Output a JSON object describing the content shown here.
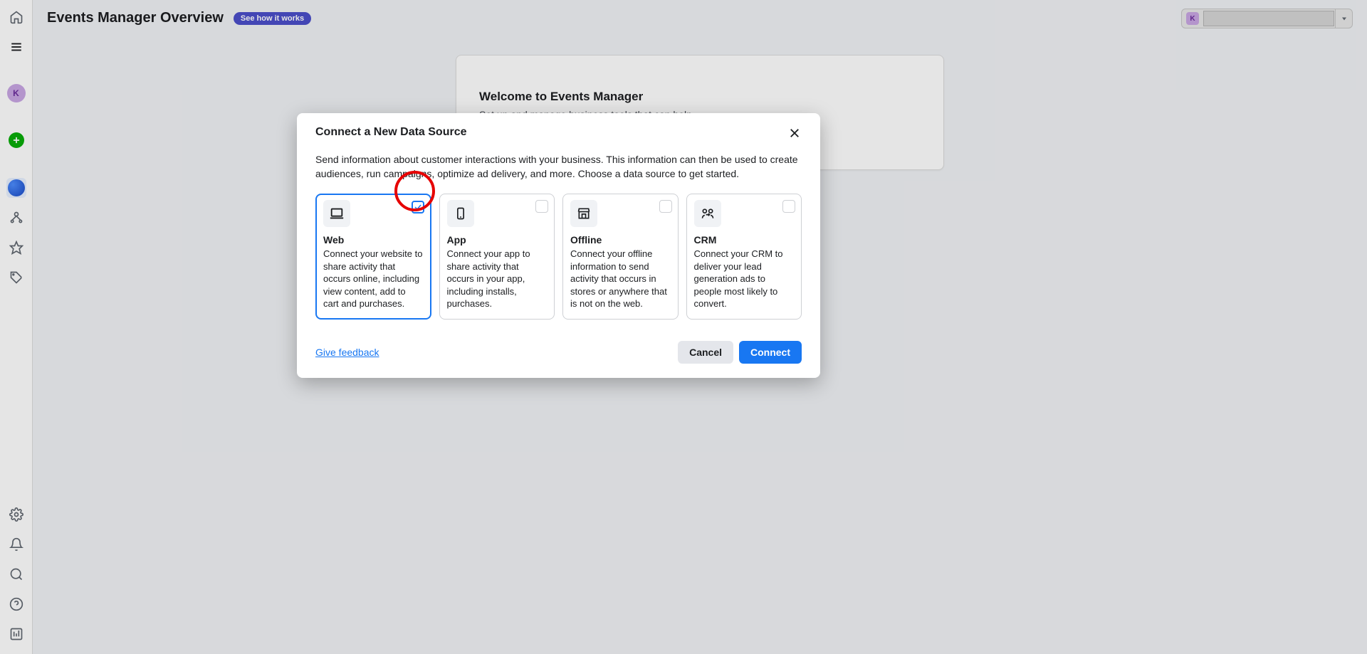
{
  "header": {
    "title": "Events Manager Overview",
    "see_how": "See how it works",
    "avatar_initial": "K"
  },
  "sidebar_avatar": "K",
  "welcome": {
    "title": "Welcome to Events Manager",
    "desc": "Set up and manage business tools that can help you optimize your ads performance."
  },
  "modal": {
    "title": "Connect a New Data Source",
    "desc": "Send information about customer interactions with your business. This information can then be used to create audiences, run campaigns, optimize ad delivery, and more. Choose a data source to get started.",
    "feedback": "Give feedback",
    "cancel": "Cancel",
    "connect": "Connect",
    "sources": {
      "web": {
        "title": "Web",
        "desc": "Connect your website to share activity that occurs online, including view content, add to cart and purchases."
      },
      "app": {
        "title": "App",
        "desc": "Connect your app to share activity that occurs in your app, including installs, purchases."
      },
      "offline": {
        "title": "Offline",
        "desc": "Connect your offline information to send activity that occurs in stores or anywhere that is not on the web."
      },
      "crm": {
        "title": "CRM",
        "desc": "Connect your CRM to deliver your lead generation ads to people most likely to convert."
      }
    }
  }
}
